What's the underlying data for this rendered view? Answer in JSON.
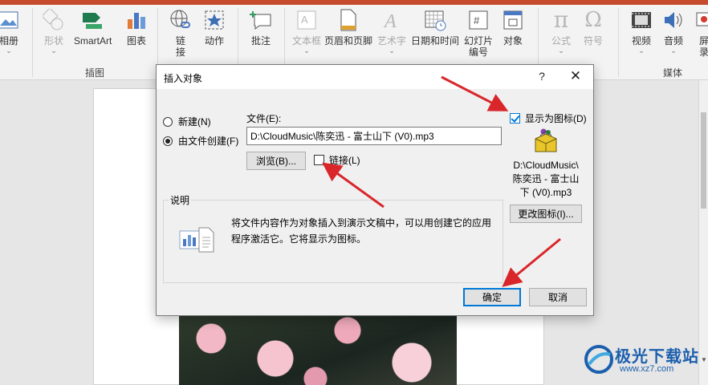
{
  "colors": {
    "accent": "#0078d7",
    "arrow": "#d9262a",
    "ribbon_bg": "#f3f3f3",
    "watermark": "#1c5fae"
  },
  "ribbon": {
    "buttons": {
      "album": "相册",
      "shapes": "形状",
      "smartart": "SmartArt",
      "chart": "图表",
      "link_1": "链",
      "link_2": "接",
      "action": "动作",
      "comment": "批注",
      "textbox": "文本框",
      "header_footer": "页眉和页脚",
      "wordart": "艺术字",
      "datetime": "日期和时间",
      "slide_number_1": "幻灯片",
      "slide_number_2": "编号",
      "object": "对象",
      "equation": "公式",
      "symbol": "符号",
      "video": "视频",
      "audio": "音频",
      "screen_recording_1": "屏",
      "screen_recording_2": "录"
    },
    "groups": {
      "illustrations": "插图",
      "media": "媒体"
    },
    "caret": "⌄"
  },
  "dialog": {
    "title": "插入对象",
    "help": "?",
    "close": "✕",
    "radio_new": "新建(N)",
    "radio_from_file": "由文件创建(F)",
    "file_label": "文件(E):",
    "file_path": "D:\\CloudMusic\\陈奕迅 - 富士山下 (V0).mp3",
    "browse": "浏览(B)...",
    "link": "链接(L)",
    "display_as_icon": "显示为图标(D)",
    "icon_caption_1": "D:\\CloudMusic\\",
    "icon_caption_2": "陈奕迅 - 富士山",
    "icon_caption_3": "下 (V0).mp3",
    "change_icon": "更改图标(I)...",
    "description_legend": "说明",
    "description_text": "将文件内容作为对象插入到演示文稿中，可以用创建它的应用程序激活它。它将显示为图标。",
    "ok": "确定",
    "cancel": "取消"
  },
  "watermark": {
    "title": "极光下载站",
    "url": "www.xz7.com"
  }
}
